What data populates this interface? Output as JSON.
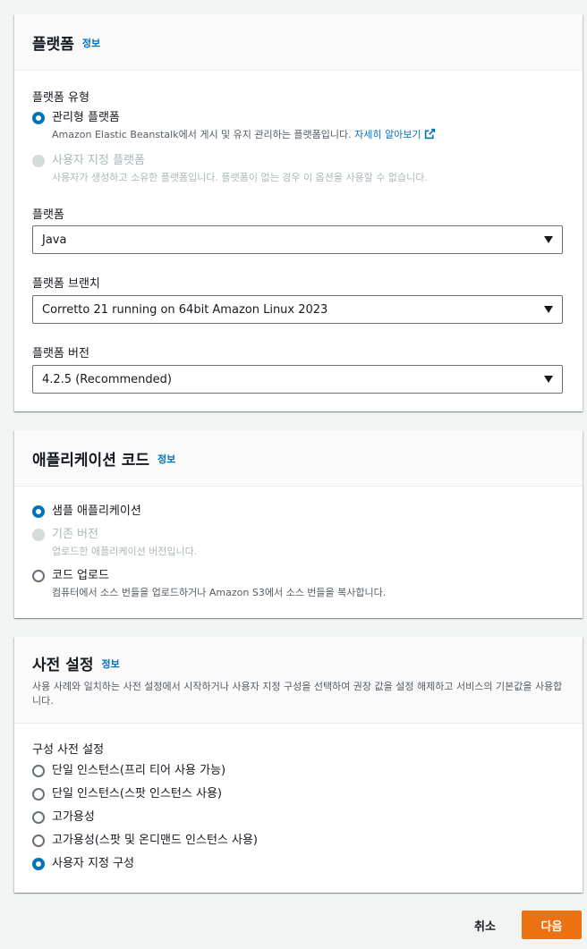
{
  "platform_panel": {
    "title": "플랫폼",
    "info": "정보",
    "platform_type_label": "플랫폼 유형",
    "options": [
      {
        "label": "관리형 플랫폼",
        "desc": "Amazon Elastic Beanstalk에서 게시 및 유지 관리하는 플랫폼입니다.",
        "link": "자세히 알아보기",
        "selected": true,
        "disabled": false
      },
      {
        "label": "사용자 지정 플랫폼",
        "desc": "사용자가 생성하고 소유한 플랫폼입니다. 플랫폼이 없는 경우 이 옵션을 사용할 수 없습니다.",
        "selected": false,
        "disabled": true
      }
    ],
    "platform_label": "플랫폼",
    "platform_value": "Java",
    "branch_label": "플랫폼 브랜치",
    "branch_value": "Corretto 21 running on 64bit Amazon Linux 2023",
    "version_label": "플랫폼 버전",
    "version_value": "4.2.5 (Recommended)"
  },
  "code_panel": {
    "title": "애플리케이션 코드",
    "info": "정보",
    "options": [
      {
        "label": "샘플 애플리케이션",
        "desc": "",
        "selected": true,
        "disabled": false
      },
      {
        "label": "기존 버전",
        "desc": "업로드한 애플리케이션 버전입니다.",
        "selected": false,
        "disabled": true
      },
      {
        "label": "코드 업로드",
        "desc": "컴퓨터에서 소스 번들을 업로드하거나 Amazon S3에서 소스 번들을 복사합니다.",
        "selected": false,
        "disabled": false
      }
    ]
  },
  "presets_panel": {
    "title": "사전 설정",
    "info": "정보",
    "desc": "사용 사례와 일치하는 사전 설정에서 시작하거나 사용자 지정 구성을 선택하여 권장 값을 설정 해제하고 서비스의 기본값을 사용합니다.",
    "config_label": "구성 사전 설정",
    "options": [
      {
        "label": "단일 인스턴스(프리 티어 사용 가능)",
        "selected": false
      },
      {
        "label": "단일 인스턴스(스팟 인스턴스 사용)",
        "selected": false
      },
      {
        "label": "고가용성",
        "selected": false
      },
      {
        "label": "고가용성(스팟 및 온디맨드 인스턴스 사용)",
        "selected": false
      },
      {
        "label": "사용자 지정 구성",
        "selected": true
      }
    ]
  },
  "footer": {
    "cancel": "취소",
    "next": "다음"
  },
  "colors": {
    "accent": "#0073bb",
    "primary_button": "#ec7211",
    "background": "#f2f3f3"
  }
}
